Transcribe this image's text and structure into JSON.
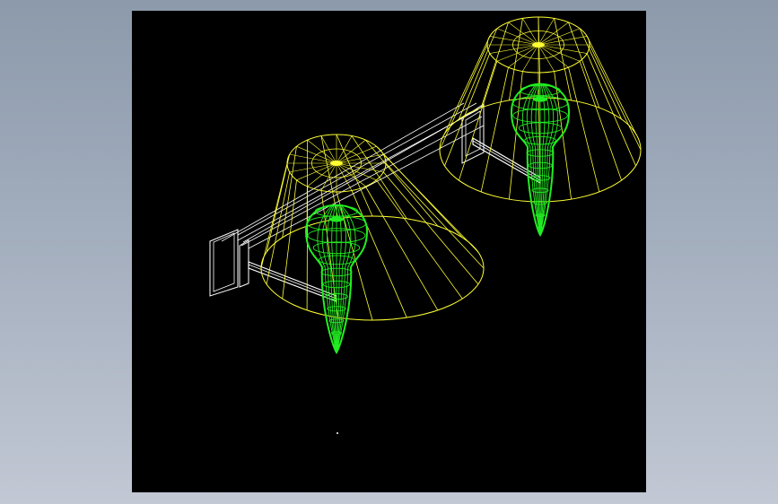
{
  "viewport": {
    "background": "#000000",
    "frame_background": "#9aa6b6"
  },
  "drawing": {
    "subject": "wall-lamp-wireframe",
    "colors": {
      "shade": "#ffff33",
      "bulb": "#22ee22",
      "bracket": "#ffffff"
    },
    "lamp_count": 2
  }
}
